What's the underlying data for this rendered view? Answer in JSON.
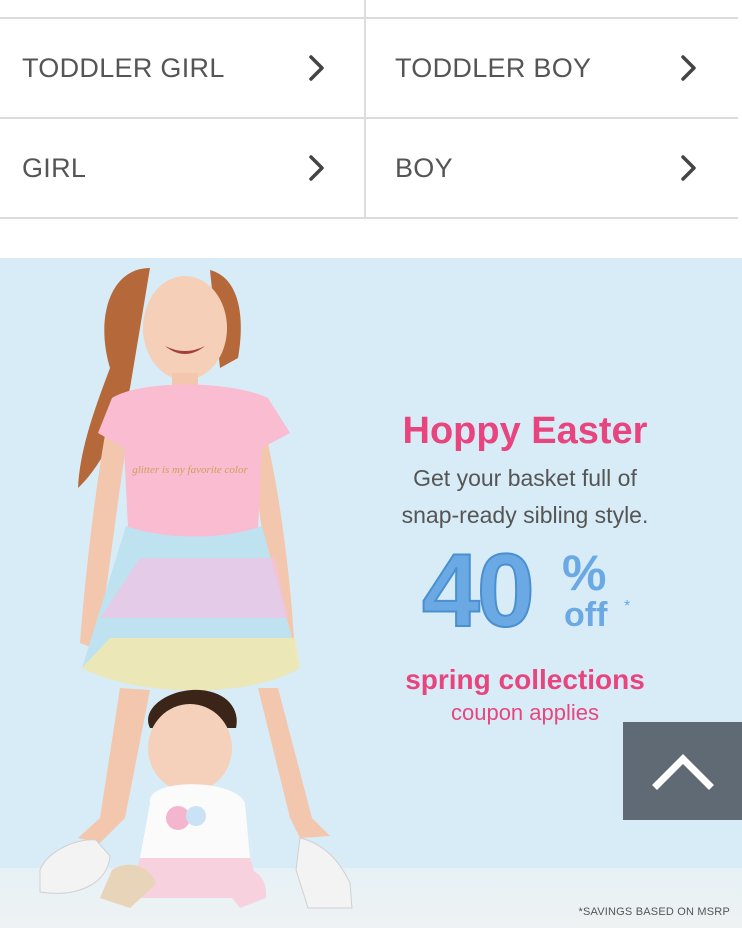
{
  "categories": {
    "rows": [
      [
        {
          "label": "TODDLER GIRL"
        },
        {
          "label": "TODDLER BOY"
        }
      ],
      [
        {
          "label": "GIRL"
        },
        {
          "label": "BOY"
        }
      ]
    ],
    "chevron_icon": "chevron-right-icon"
  },
  "banner": {
    "shirt_text": "glitter is my favorite color",
    "headline": "Hoppy Easter",
    "sub_line1": "Get your basket full of",
    "sub_line2": "snap-ready sibling style.",
    "discount_number": "40",
    "discount_percent": "%",
    "discount_off": "off",
    "discount_asterisk": "*",
    "collections": "spring collections",
    "coupon": "coupon applies",
    "disclaimer": "*SAVINGS BASED ON MSRP",
    "colors": {
      "pink": "#e8457f",
      "blue": "#6aa9e4",
      "background": "#d8ecf7"
    }
  },
  "scroll_to_top": {
    "icon": "chevron-up-icon",
    "color": "#5f6a74"
  }
}
